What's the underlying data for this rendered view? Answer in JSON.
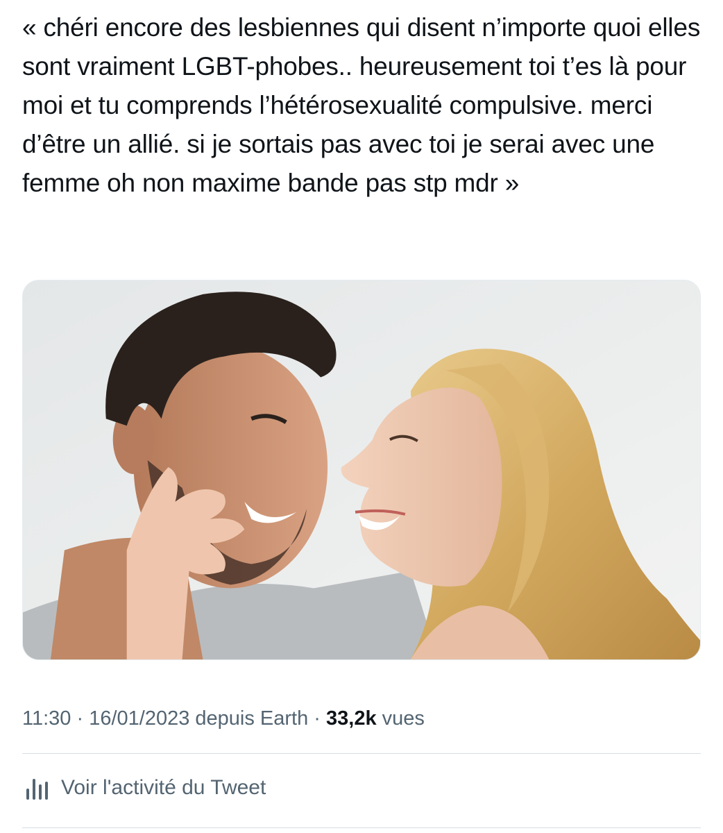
{
  "tweet": {
    "text": "« chéri encore des lesbiennes qui disent n’importe quoi elles sont vraiment LGBT-phobes.. heureusement toi t’es là pour moi et tu comprends l’hétérosexualité compulsive. merci d’être un allié. si je sortais pas avec toi je serai avec une femme oh non maxime bande pas stp mdr »",
    "media": {
      "description_icon": "photo-of-smiling-couple"
    },
    "meta": {
      "time": "11:30",
      "separator": " · ",
      "date": "16/01/2023",
      "source": " depuis Earth",
      "views_count": "33,2k",
      "views_label": " vues"
    },
    "activity_label": "Voir l'activité du Tweet",
    "activity_icon": "analytics-bars-icon"
  },
  "colors": {
    "text_primary": "#0f1419",
    "text_secondary": "#536471",
    "divider": "#d6dde2"
  }
}
